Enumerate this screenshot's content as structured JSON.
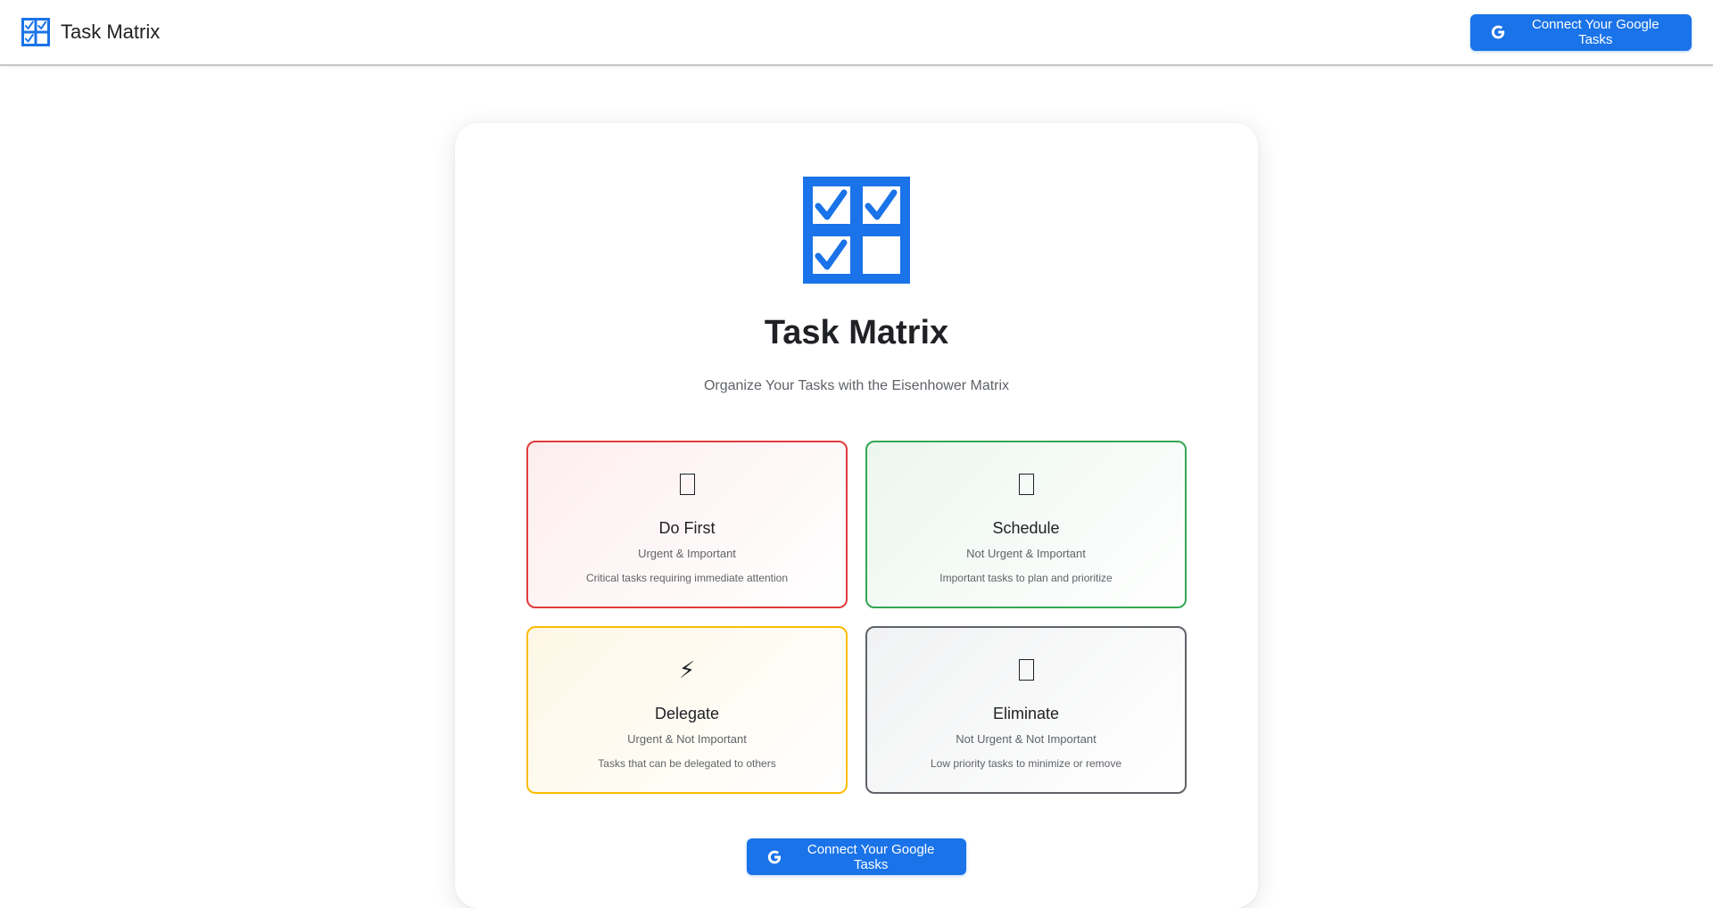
{
  "header": {
    "app_title": "Task Matrix",
    "logo_icon": "checkbox-grid-icon",
    "connect_label": "Connect Your Google Tasks"
  },
  "hero": {
    "logo_icon": "checkbox-grid-icon",
    "title": "Task Matrix",
    "subtitle": "Organize Your Tasks with the Eisenhower Matrix"
  },
  "quadrants": [
    {
      "title": "Do First",
      "subtitle": "Urgent & Important",
      "description": "Critical tasks requiring immediate attention",
      "icon": "emoji-placeholder-icon",
      "color": "#e03c3c"
    },
    {
      "title": "Schedule",
      "subtitle": "Not Urgent & Important",
      "description": "Important tasks to plan and prioritize",
      "icon": "emoji-placeholder-icon",
      "color": "#34a853"
    },
    {
      "title": "Delegate",
      "subtitle": "Urgent & Not Important",
      "description": "Tasks that can be delegated to others",
      "icon": "lightning-icon",
      "glyph": "⚡",
      "color": "#fbbc04"
    },
    {
      "title": "Eliminate",
      "subtitle": "Not Urgent & Not Important",
      "description": "Low priority tasks to minimize or remove",
      "icon": "emoji-placeholder-icon",
      "color": "#5f6368"
    }
  ],
  "cta": {
    "connect_label": "Connect Your Google Tasks",
    "icon": "google-icon"
  },
  "colors": {
    "primary": "#1a73e8",
    "text": "#202124",
    "muted": "#5f6368"
  }
}
